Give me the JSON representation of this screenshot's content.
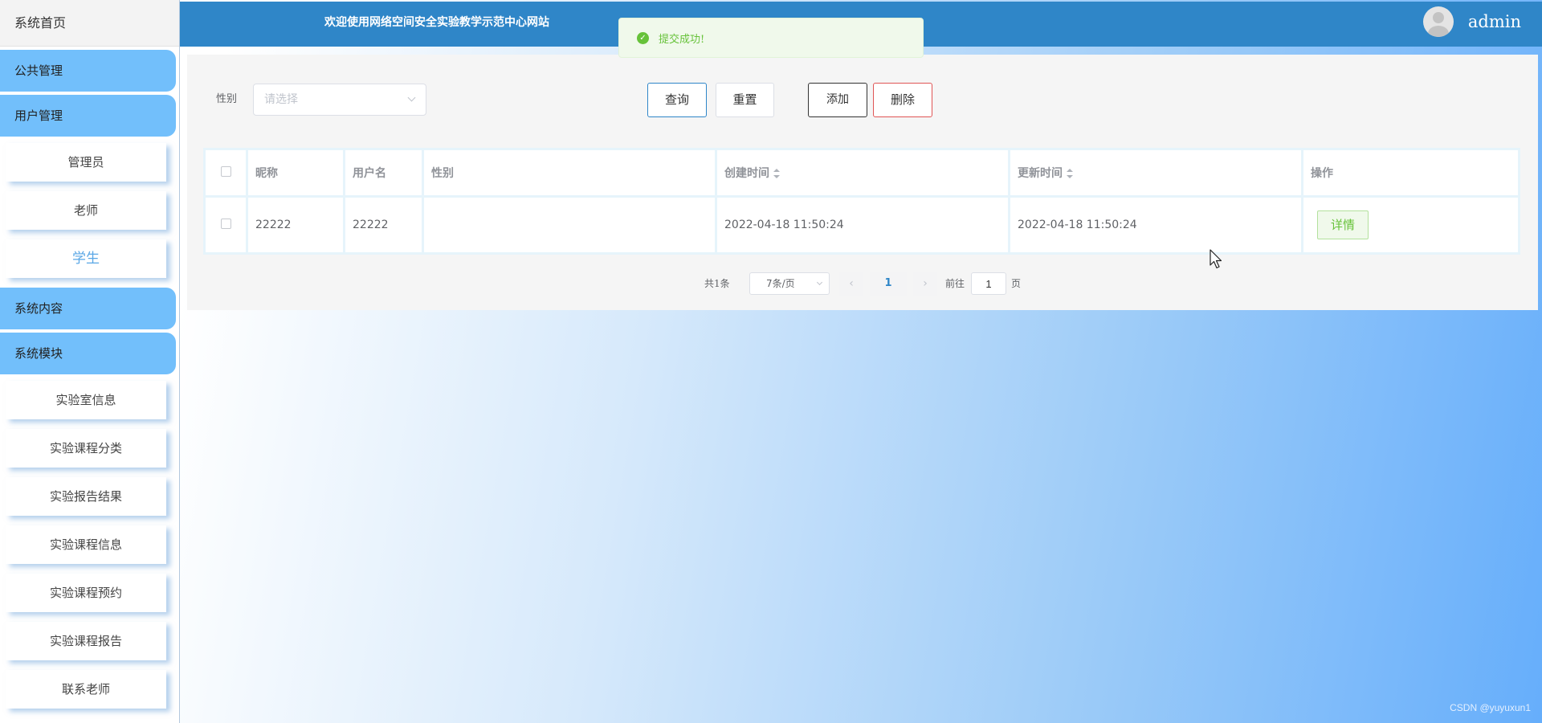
{
  "sidebar": {
    "home_label": "系统首页",
    "groups": [
      {
        "label": "公共管理",
        "children": []
      },
      {
        "label": "用户管理",
        "children": [
          "管理员",
          "老师",
          "学生"
        ],
        "active_child": "学生"
      },
      {
        "label": "系统内容",
        "children": []
      },
      {
        "label": "系统模块",
        "children": [
          "实验室信息",
          "实验课程分类",
          "实验报告结果",
          "实验课程信息",
          "实验课程预约",
          "实验课程报告",
          "联系老师"
        ]
      }
    ]
  },
  "header": {
    "welcome": "欢迎使用网络空间安全实验教学示范中心网站",
    "username": "admin",
    "avatar_icon": "user-avatar-icon"
  },
  "toast": {
    "text": "提交成功!",
    "type": "success",
    "icon": "check-circle-icon"
  },
  "search": {
    "gender_label": "性别",
    "gender_placeholder": "请选择",
    "query_label": "查询",
    "reset_label": "重置",
    "add_label": "添加",
    "delete_label": "删除"
  },
  "table": {
    "columns": [
      "昵称",
      "用户名",
      "性别",
      "创建时间",
      "更新时间",
      "操作"
    ],
    "sortable": [
      "创建时间",
      "更新时间"
    ],
    "rows": [
      {
        "nickname": "22222",
        "username": "22222",
        "gender": "",
        "created": "2022-04-18 11:50:24",
        "updated": "2022-04-18 11:50:24",
        "action": "详情"
      }
    ]
  },
  "pagination": {
    "total_text": "共1条",
    "page_size_text": "7条/页",
    "current_page": "1",
    "goto_label": "前往",
    "goto_value": "1",
    "page_suffix": "页"
  },
  "watermark": "CSDN @yuyuxun1",
  "colors": {
    "header": "#2f86c8",
    "sidebar_group": "#72bffb",
    "success": "#67c23a",
    "danger": "#e05555"
  }
}
